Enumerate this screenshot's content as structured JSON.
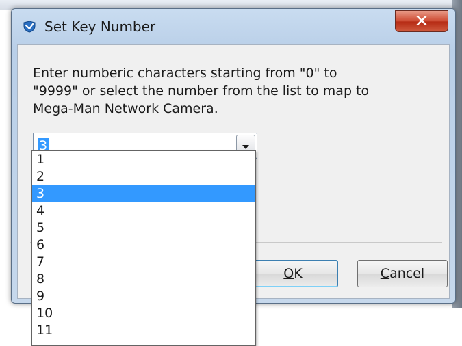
{
  "dialog": {
    "title": "Set Key Number",
    "title_icon": "app-shield-icon",
    "close_icon": "close-icon",
    "message_lines": [
      "Enter numberic characters starting from \"0\" to",
      "\"9999\" or select the number from the list to map to",
      "Mega-Man Network Camera."
    ],
    "combo": {
      "value": "3",
      "arrow_icon": "chevron-down-icon"
    },
    "dropdown_items": [
      "1",
      "2",
      "3",
      "4",
      "5",
      "6",
      "7",
      "8",
      "9",
      "10",
      "11"
    ],
    "selected_item": "3",
    "buttons": {
      "ok_label": "OK",
      "ok_mnemonic": "O",
      "cancel_label": "Cancel",
      "cancel_mnemonic": "C"
    }
  },
  "colors": {
    "selection": "#3399ff",
    "close_button": "#c8452d",
    "titlebar": "#c9dcf0"
  }
}
